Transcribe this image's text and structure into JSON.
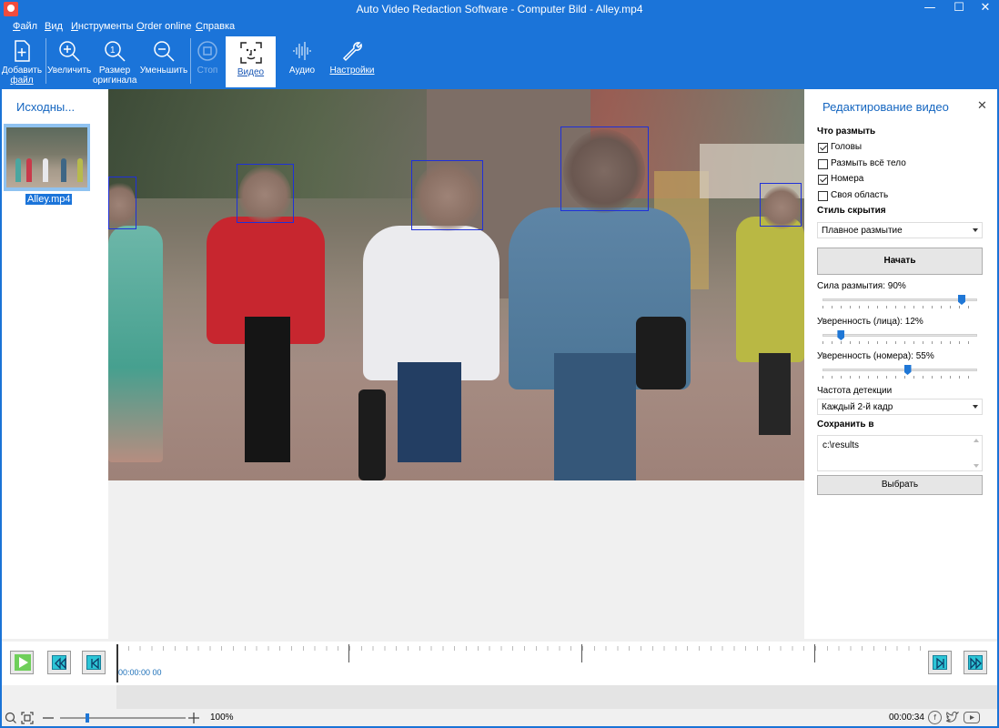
{
  "window": {
    "title": "Auto Video Redaction Software - Computer Bild - Alley.mp4",
    "minimize_glyph": "—",
    "maximize_glyph": "☐",
    "close_glyph": "✕"
  },
  "menu": [
    {
      "hot": "Ф",
      "rest": "айл"
    },
    {
      "hot": "В",
      "rest": "ид"
    },
    {
      "hot": "И",
      "rest": "нструменты"
    },
    {
      "hot": "O",
      "rest": "rder online"
    },
    {
      "hot": "С",
      "rest": "правка"
    }
  ],
  "ribbon": {
    "add_file": [
      "Добавить",
      "файл"
    ],
    "zoom_in": "Увеличить",
    "original_size": [
      "Размер",
      "оригинала"
    ],
    "zoom_out": "Уменьшить",
    "stop": "Стоп",
    "video": "Видео",
    "audio": "Аудио",
    "settings": "Настройки"
  },
  "sources": {
    "title": "Исходны...",
    "items": [
      {
        "name": "Alley.mp4",
        "selected": true
      }
    ]
  },
  "video_panel": {
    "title": "Редактирование видео",
    "close_glyph": "✕",
    "what_to_blur_title": "Что размыть",
    "options": [
      {
        "label": "Головы",
        "checked": true
      },
      {
        "label": "Размыть всё тело",
        "checked": false
      },
      {
        "label": "Номера",
        "checked": true
      },
      {
        "label": "Своя область",
        "checked": false
      }
    ],
    "hide_style_title": "Стиль скрытия",
    "hide_style_value": "Плавное размытие",
    "start_button": "Начать",
    "blur_strength_label": "Сила размытия: 90%",
    "blur_strength": 0.9,
    "face_confidence_label": "Уверенность (лица): 12%",
    "face_confidence": 0.12,
    "plate_confidence_label": "Уверенность (номера): 55%",
    "plate_confidence": 0.55,
    "detect_freq_title": "Частота детекции",
    "detect_freq_value": "Каждый 2-й кадр",
    "save_to_title": "Сохранить в",
    "save_path": "c:\\results",
    "choose_button": "Выбрать"
  },
  "timeline": {
    "current_time": "00:00:00 00",
    "duration": "00:00:34",
    "zoom": "100%",
    "zoom_level": 0.22
  },
  "colors": {
    "accent": "#1b74d9",
    "detection_box": "#1f30d9",
    "timeline_button": "#2cc5d6"
  }
}
